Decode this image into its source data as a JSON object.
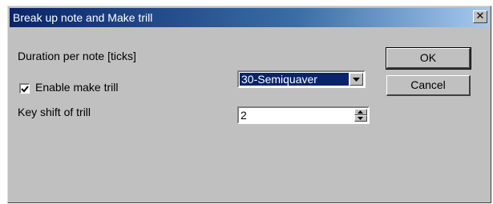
{
  "dialog": {
    "title": "Break up note and Make trill",
    "close_icon": "close-icon"
  },
  "duration": {
    "label": "Duration per note [ticks]",
    "selected": "30-Semiquaver"
  },
  "trill": {
    "checkbox_label": "Enable make trill",
    "checked": true
  },
  "key_shift": {
    "label": "Key shift of trill",
    "value": "2"
  },
  "buttons": {
    "ok": "OK",
    "cancel": "Cancel"
  }
}
